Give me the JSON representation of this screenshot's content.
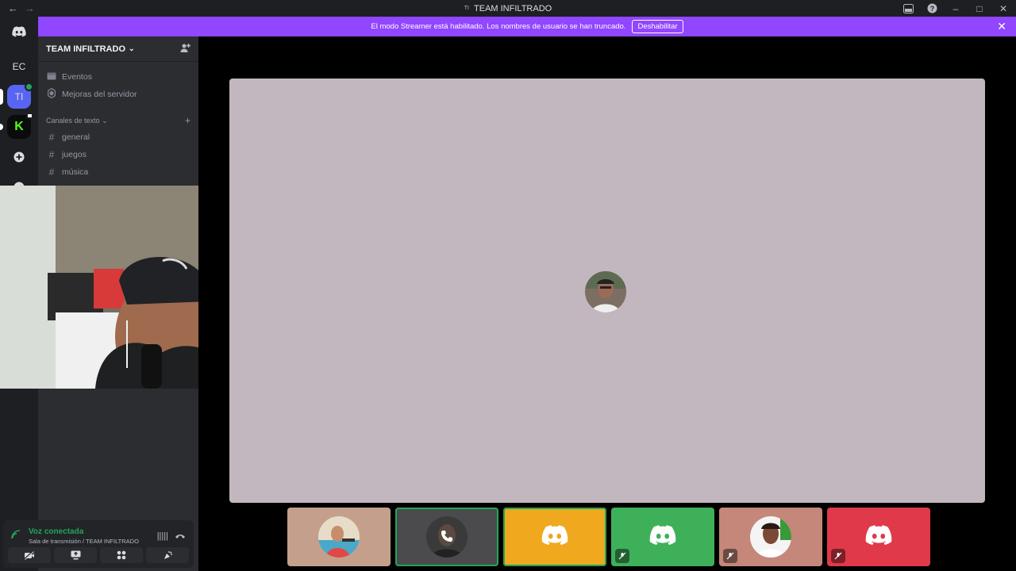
{
  "titlebar": {
    "back_icon": "arrow-left-icon",
    "forward_icon": "arrow-right-icon",
    "server_abbr": "TI",
    "title": "TEAM INFILTRADO",
    "icons": [
      "inbox-icon",
      "help-icon",
      "minimize-icon",
      "maximize-icon",
      "close-icon"
    ]
  },
  "guilds": {
    "items": [
      {
        "label": "",
        "icon": "discord-home-icon"
      },
      {
        "label": "EC"
      },
      {
        "label": "TI",
        "active": true
      },
      {
        "label": "K",
        "icon": "kick-icon"
      },
      {
        "label": "",
        "icon": "add-server-icon"
      },
      {
        "label": "",
        "icon": "explore-icon"
      }
    ]
  },
  "banner": {
    "text": "El modo Streamer está habilitado. Los nombres de usuario se han truncado.",
    "button": "Deshabilitar",
    "color": "#9146ff"
  },
  "sidebar": {
    "server_name": "TEAM INFILTRADO",
    "items": [
      {
        "label": "Eventos",
        "icon": "calendar-icon"
      },
      {
        "label": "Mejoras del servidor",
        "icon": "boost-icon"
      }
    ],
    "category": "Canales de texto",
    "channels": [
      "general",
      "juegos",
      "música"
    ]
  },
  "voice": {
    "status": "Voz conectada",
    "channel": "Sala de transmisión / TEAM INFILTRADO",
    "status_color": "#23a55a"
  },
  "stage": {
    "main_tile_color": "#c3b7bf",
    "tiles": [
      {
        "kind": "avatar",
        "bg": "#c4a08c",
        "muted": false,
        "speaking": false
      },
      {
        "kind": "avatar-call",
        "bg": "#4b4a4c",
        "muted": false,
        "speaking": true
      },
      {
        "kind": "discord",
        "bg": "#f0a81f",
        "muted": false,
        "speaking": true
      },
      {
        "kind": "discord",
        "bg": "#3fb05a",
        "muted": true,
        "speaking": false
      },
      {
        "kind": "avatar",
        "bg": "#c4877a",
        "muted": true,
        "speaking": false
      },
      {
        "kind": "discord",
        "bg": "#e0394a",
        "muted": true,
        "speaking": false
      }
    ]
  }
}
